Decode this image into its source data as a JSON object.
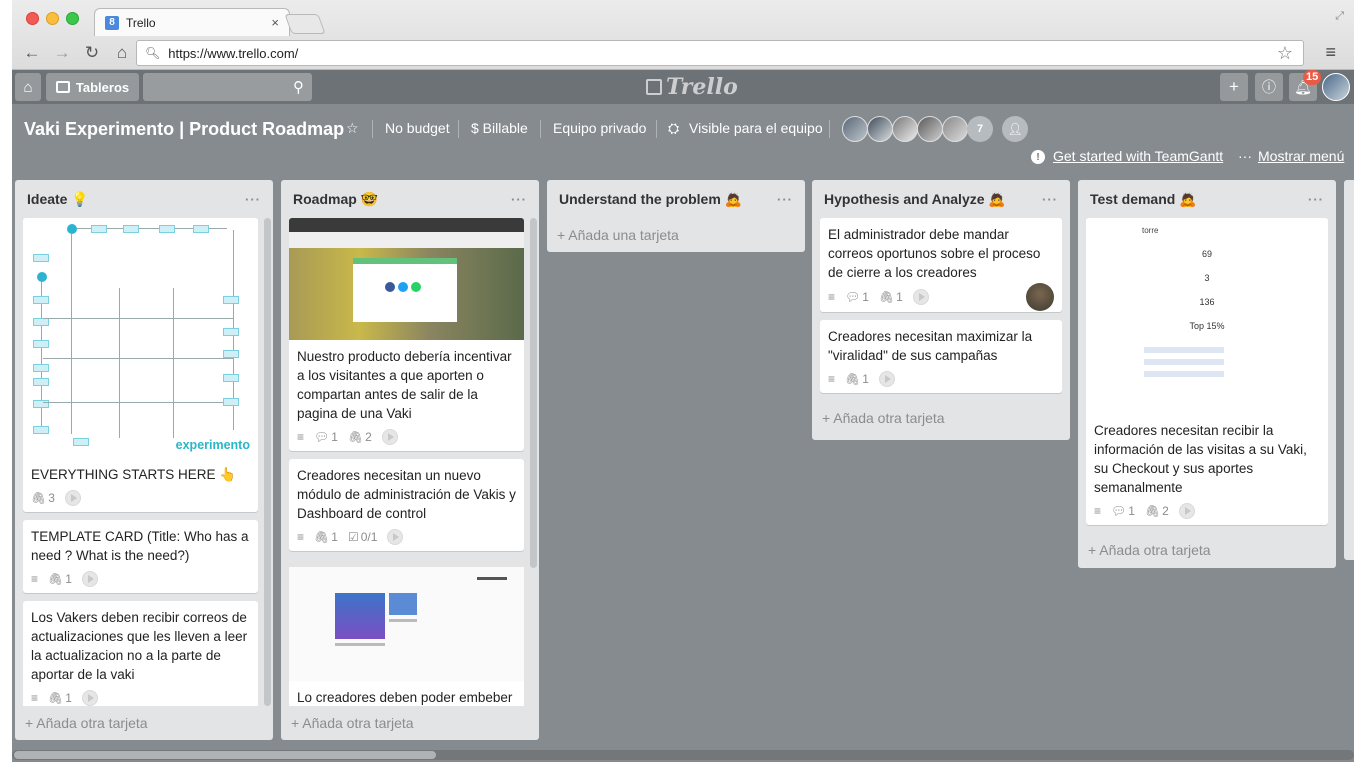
{
  "browser": {
    "tab_title": "Trello",
    "tab_favicon": "8",
    "tab_close": "×",
    "url": "https://www.trello.com/"
  },
  "topbar": {
    "boards_label": "Tableros",
    "logo_text": "Trello",
    "notification_count": "15"
  },
  "board": {
    "title": "Vaki Experimento | Product Roadmap",
    "budget": "No budget",
    "billable": "$ Billable",
    "team": "Equipo privado",
    "visibility": "Visible para el equipo",
    "member_extra_count": "7",
    "teamgantt_link": "Get started with TeamGantt",
    "show_menu": "Mostrar menú"
  },
  "lists": [
    {
      "title": "Ideate 💡",
      "add_label": "+ Añada otra tarjeta",
      "cards": [
        {
          "text": "EVERYTHING STARTS HERE 👆",
          "attachments": "3",
          "cover_brand": "experimento"
        },
        {
          "text": "TEMPLATE CARD (Title: Who has a need ? What is the need?)",
          "attachments": "1"
        },
        {
          "text": "Los Vakers deben recibir correos de actualizaciones que les lleven a leer la actualizacion no a la parte de aportar de la vaki",
          "attachments": "1"
        }
      ]
    },
    {
      "title": "Roadmap 🤓",
      "add_label": "+ Añada otra tarjeta",
      "cards": [
        {
          "text": "Nuestro producto debería incentivar a los visitantes a que aporten o compartan antes de salir de la pagina de una Vaki",
          "comments": "1",
          "attachments": "2"
        },
        {
          "text": "Creadores necesitan un nuevo módulo de administración de Vakis y Dashboard de control",
          "attachments": "1",
          "checklist": "0/1"
        },
        {
          "text": "Lo creadores deben poder embeber"
        }
      ]
    },
    {
      "title": "Understand the problem 🙇",
      "add_label": "+ Añada una tarjeta",
      "cards": []
    },
    {
      "title": "Hypothesis and Analyze 🙇",
      "add_label": "+ Añada otra tarjeta",
      "cards": [
        {
          "text": "El administrador debe mandar correos oportunos sobre el proceso de cierre a los creadores",
          "comments": "1",
          "attachments": "1"
        },
        {
          "text": "Creadores necesitan maximizar la \"viralidad\" de sus campañas",
          "attachments": "1"
        }
      ]
    },
    {
      "title": "Test demand 🙇",
      "add_label": "+ Añada otra tarjeta",
      "cards": [
        {
          "text": "Creadores necesitan recibir la información de las visitas a su Vaki, su Checkout y sus aportes semanalmente",
          "comments": "1",
          "attachments": "2",
          "cover_title": "torre",
          "cover_stats": [
            "69",
            "3",
            "136",
            "Top 15%"
          ]
        }
      ]
    }
  ],
  "icons": {
    "home": "home-icon",
    "boards": "boards-icon",
    "search": "search-icon",
    "add": "plus-icon",
    "info": "info-icon",
    "bell": "bell-icon",
    "star": "star-icon",
    "description": "description-icon",
    "comment": "comment-icon",
    "attachment": "paperclip-icon",
    "checklist": "checklist-icon"
  },
  "colors": {
    "board_bg": "#868b90",
    "topbar_bg": "#6d7276",
    "list_bg": "#e2e4e6",
    "badge_red": "#eb5a46",
    "brand_teal": "#29b6c8"
  }
}
